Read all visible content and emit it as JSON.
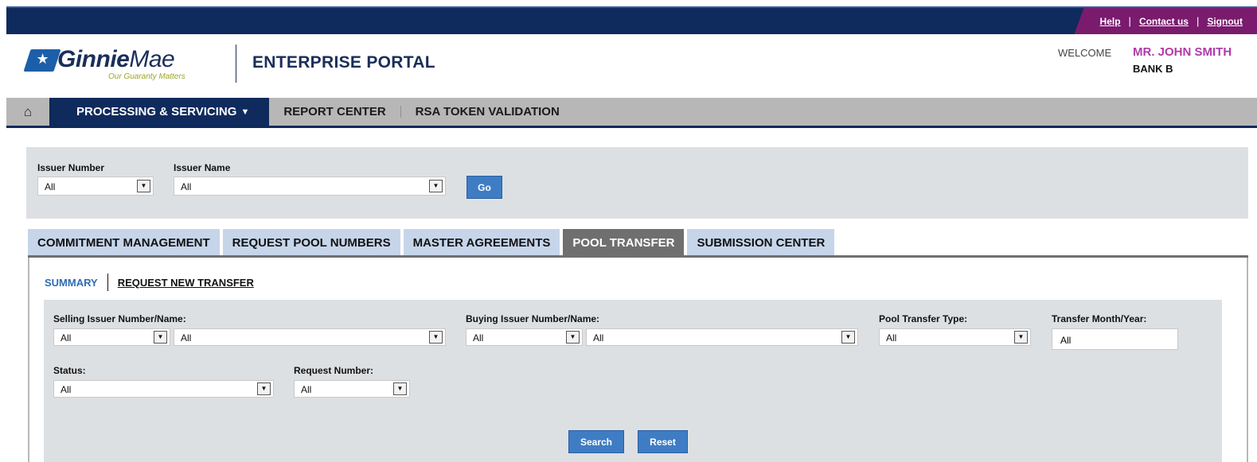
{
  "toplinks": {
    "help": "Help",
    "contact": "Contact us",
    "signout": "Signout",
    "sep": "|"
  },
  "header": {
    "logo_bold": "Ginnie",
    "logo_light": "Mae",
    "tagline": "Our Guaranty Matters",
    "portal_title": "ENTERPRISE PORTAL",
    "welcome_label": "WELCOME",
    "user_name": "MR. JOHN SMITH",
    "bank": "BANK B"
  },
  "nav": {
    "home_icon": "home-icon",
    "items": [
      {
        "label": "PROCESSING & SERVICING"
      },
      {
        "label": "REPORT CENTER"
      },
      {
        "label": "RSA TOKEN VALIDATION"
      }
    ]
  },
  "filter": {
    "issuer_number_label": "Issuer Number",
    "issuer_number_value": "All",
    "issuer_name_label": "Issuer Name",
    "issuer_name_value": "All",
    "go_label": "Go"
  },
  "tabs": [
    {
      "label": "COMMITMENT MANAGEMENT"
    },
    {
      "label": "REQUEST POOL NUMBERS"
    },
    {
      "label": "MASTER AGREEMENTS"
    },
    {
      "label": "POOL TRANSFER"
    },
    {
      "label": "SUBMISSION CENTER"
    }
  ],
  "subtabs": {
    "summary": "SUMMARY",
    "request_new": "REQUEST NEW TRANSFER"
  },
  "search": {
    "selling_label": "Selling Issuer Number/Name:",
    "selling_number": "All",
    "selling_name": "All",
    "buying_label": "Buying Issuer Number/Name:",
    "buying_number": "All",
    "buying_name": "All",
    "pool_type_label": "Pool Transfer Type:",
    "pool_type_value": "All",
    "month_year_label": "Transfer Month/Year:",
    "month_year_value": "All",
    "status_label": "Status:",
    "status_value": "All",
    "request_number_label": "Request Number:",
    "request_number_value": "All",
    "search_button": "Search",
    "reset_button": "Reset"
  },
  "colors": {
    "navy": "#0f2a5c",
    "accent_purple": "#7a1b6e",
    "button_blue": "#3e7dc4",
    "tab_light": "#c6d5ea",
    "tab_active": "#6f6f6f"
  }
}
